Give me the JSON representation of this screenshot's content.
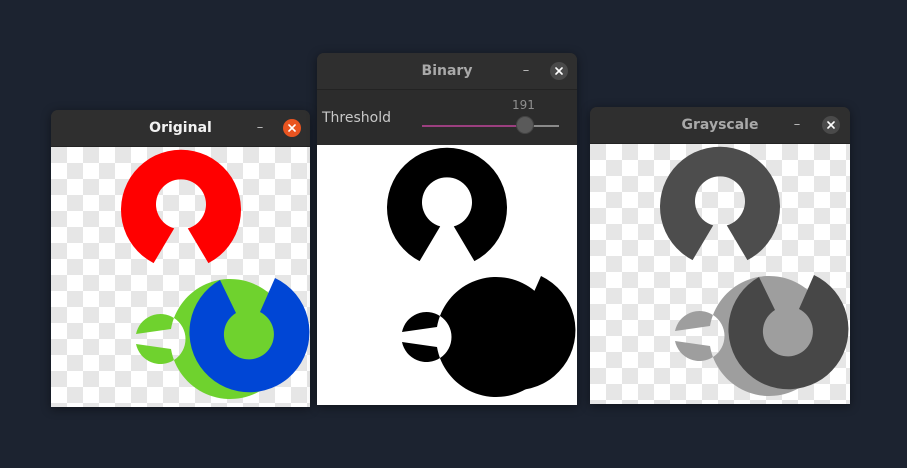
{
  "windows": {
    "original": {
      "title": "Original",
      "state": "active",
      "minimize_symbol": "–"
    },
    "binary": {
      "title": "Binary",
      "state": "inactive",
      "minimize_symbol": "–"
    },
    "grayscale": {
      "title": "Grayscale",
      "state": "inactive",
      "minimize_symbol": "–"
    }
  },
  "trackbar": {
    "label": "Threshold",
    "value": "191",
    "fraction": 0.749,
    "fill_color": "#9b3f7f"
  },
  "colors": {
    "desktop_bg": "#1c2330",
    "close_active": "#e95420",
    "logo_red": "#ff0000",
    "logo_green": "#6fd22e",
    "logo_blue": "#0046d5",
    "gray_top": "#4d4d4d",
    "gray_left": "#9e9e9e",
    "gray_right": "#474747",
    "checker_light": "#ffffff",
    "checker_dark": "#e6e6e6"
  },
  "icons": [
    "close-icon",
    "minimize-icon"
  ]
}
